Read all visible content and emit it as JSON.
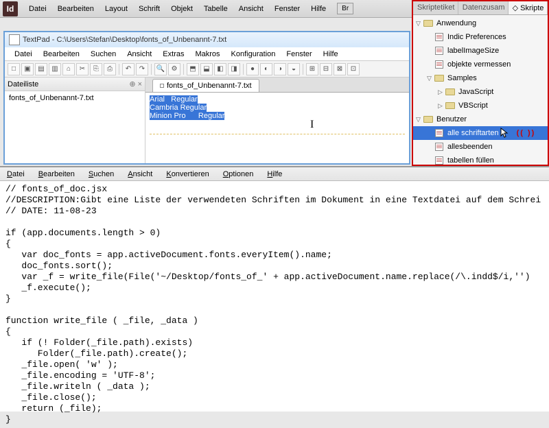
{
  "indesign": {
    "logo": "Id",
    "menus": [
      "Datei",
      "Bearbeiten",
      "Layout",
      "Schrift",
      "Objekt",
      "Tabelle",
      "Ansicht",
      "Fenster",
      "Hilfe"
    ],
    "br": "Br"
  },
  "scripts_panel": {
    "tabs": [
      "Skriptetiket",
      "Datenzusam",
      "Skripte"
    ],
    "active_tab": 2,
    "tree": [
      {
        "type": "folder",
        "label": "Anwendung",
        "indent": 0,
        "expanded": true
      },
      {
        "type": "script",
        "label": "Indic Preferences",
        "indent": 1
      },
      {
        "type": "script",
        "label": "labelImageSize",
        "indent": 1
      },
      {
        "type": "script",
        "label": "objekte vermessen",
        "indent": 1
      },
      {
        "type": "folder",
        "label": "Samples",
        "indent": 1,
        "expanded": true
      },
      {
        "type": "folder",
        "label": "JavaScript",
        "indent": 2,
        "expanded": false
      },
      {
        "type": "folder",
        "label": "VBScript",
        "indent": 2,
        "expanded": false
      },
      {
        "type": "folder",
        "label": "Benutzer",
        "indent": 0,
        "expanded": true
      },
      {
        "type": "script",
        "label": "alle schriftarten",
        "indent": 1,
        "selected": true,
        "parens": true
      },
      {
        "type": "script",
        "label": "allesbeenden",
        "indent": 1
      },
      {
        "type": "script",
        "label": "tabellen füllen",
        "indent": 1
      }
    ]
  },
  "textpad": {
    "title": "TextPad - C:\\Users\\Stefan\\Desktop\\fonts_of_Unbenannt-7.txt",
    "menus": [
      "Datei",
      "Bearbeiten",
      "Suchen",
      "Ansicht",
      "Extras",
      "Makros",
      "Konfiguration",
      "Fenster",
      "Hilfe"
    ],
    "left_header": "Dateiliste",
    "left_items": [
      "fonts_of_Unbenannt-7.txt"
    ],
    "tab_label": "fonts_of_Unbenannt-7.txt",
    "content_lines": [
      "Arial   Regular",
      "Cambria Regular",
      "Minion Pro      Regular"
    ]
  },
  "bottom_editor": {
    "menus": [
      "Datei",
      "Bearbeiten",
      "Suchen",
      "Ansicht",
      "Konvertieren",
      "Optionen",
      "Hilfe"
    ],
    "code": "// fonts_of_doc.jsx\n//DESCRIPTION:Gibt eine Liste der verwendeten Schriften im Dokument in eine Textdatei auf dem Schrei\n// DATE: 11-08-23\n\nif (app.documents.length > 0)\n{\n   var doc_fonts = app.activeDocument.fonts.everyItem().name;\n   doc_fonts.sort();\n   var _f = write_file(File('~/Desktop/fonts_of_' + app.activeDocument.name.replace(/\\.indd$/i,'')\n   _f.execute();\n}\n\nfunction write_file ( _file, _data )\n{\n   if (! Folder(_file.path).exists)\n      Folder(_file.path).create();\n   _file.open( 'w' );\n   _file.encoding = 'UTF-8';\n   _file.writeln ( _data );\n   _file.close();\n   return (_file);\n}"
  }
}
